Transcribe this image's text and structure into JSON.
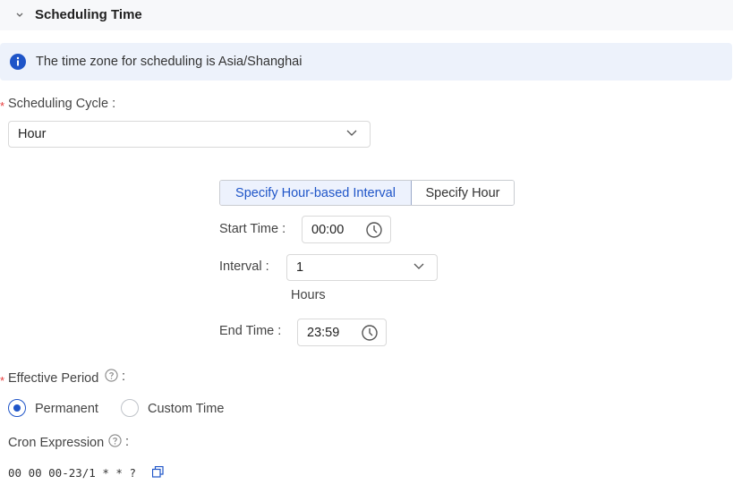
{
  "section": {
    "title": "Scheduling Time"
  },
  "info": {
    "text": "The time zone for scheduling is Asia/Shanghai"
  },
  "cycle": {
    "required_mark": "*",
    "label": "Scheduling Cycle :",
    "value": "Hour"
  },
  "mode": {
    "options": [
      "Specify Hour-based Interval",
      "Specify Hour"
    ],
    "active_index": 0
  },
  "start_time": {
    "label": "Start Time :",
    "value": "00:00"
  },
  "interval": {
    "label": "Interval :",
    "value": "1",
    "unit": "Hours"
  },
  "end_time": {
    "label": "End Time :",
    "value": "23:59"
  },
  "effective": {
    "required_mark": "*",
    "label": "Effective Period",
    "colon": ":",
    "options": [
      "Permanent",
      "Custom Time"
    ],
    "selected": "Permanent"
  },
  "cron": {
    "label": "Cron Expression",
    "colon": ":",
    "value": "00 00 00-23/1 * * ?"
  },
  "colors": {
    "accent": "#1f55c8",
    "required": "#e63b3b",
    "info_bg": "#edf2fb"
  }
}
